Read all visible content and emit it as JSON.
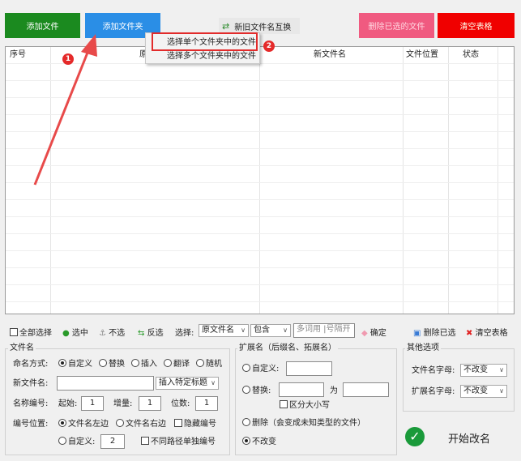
{
  "toolbar": {
    "add_file": "添加文件",
    "add_folder": "添加文件夹",
    "swap_names": "新旧文件名互换",
    "delete_selected": "删除已选的文件",
    "clear_table": "清空表格"
  },
  "table": {
    "columns": [
      "序号",
      "原",
      "新文件名",
      "文件位置",
      "状态"
    ]
  },
  "context_menu": {
    "items": [
      "选择单个文件夹中的文件",
      "选择多个文件夹中的文件"
    ]
  },
  "badges": {
    "step1": "1",
    "step2": "2"
  },
  "toolbar2": {
    "select_all": "全部选择",
    "select": "选中",
    "deselect": "不选",
    "invert": "反选",
    "select_label": "选择:",
    "field_value": "原文件名",
    "match_value": "包含",
    "keywords_placeholder": "多词用 |号隔开",
    "confirm": "确定",
    "delete_selected": "删除已选",
    "clear_table": "清空表格"
  },
  "filename": {
    "title": "文件名",
    "naming_label": "命名方式:",
    "modes": [
      "自定义",
      "替换",
      "插入",
      "翻译",
      "随机"
    ],
    "new_name_label": "新文件名:",
    "new_name_value": "",
    "insert_title": "插入特定标题",
    "number_label": "名称编号:",
    "start_label": "起始:",
    "start_value": "1",
    "increment_label": "增量:",
    "increment_value": "1",
    "digits_label": "位数:",
    "digits_value": "1",
    "position_label": "编号位置:",
    "pos_left": "文件名左边",
    "pos_right": "文件名右边",
    "hide_number": "隐藏编号",
    "pos_custom": "自定义:",
    "pos_custom_value": "2",
    "separate_numbering": "不同路径单独编号"
  },
  "extension": {
    "title": "扩展名（后缀名、拓展名）",
    "custom": "自定义:",
    "custom_value": "",
    "replace": "替换:",
    "replace_from": "",
    "to_label": "为",
    "replace_to": "",
    "case_sensitive": "区分大小写",
    "delete": "删除（会变成未知类型的文件）",
    "no_change": "不改变"
  },
  "other": {
    "title": "其他选项",
    "filename_case_label": "文件名字母:",
    "filename_case_value": "不改变",
    "ext_case_label": "扩展名字母:",
    "ext_case_value": "不改变"
  },
  "start_button": "开始改名"
}
